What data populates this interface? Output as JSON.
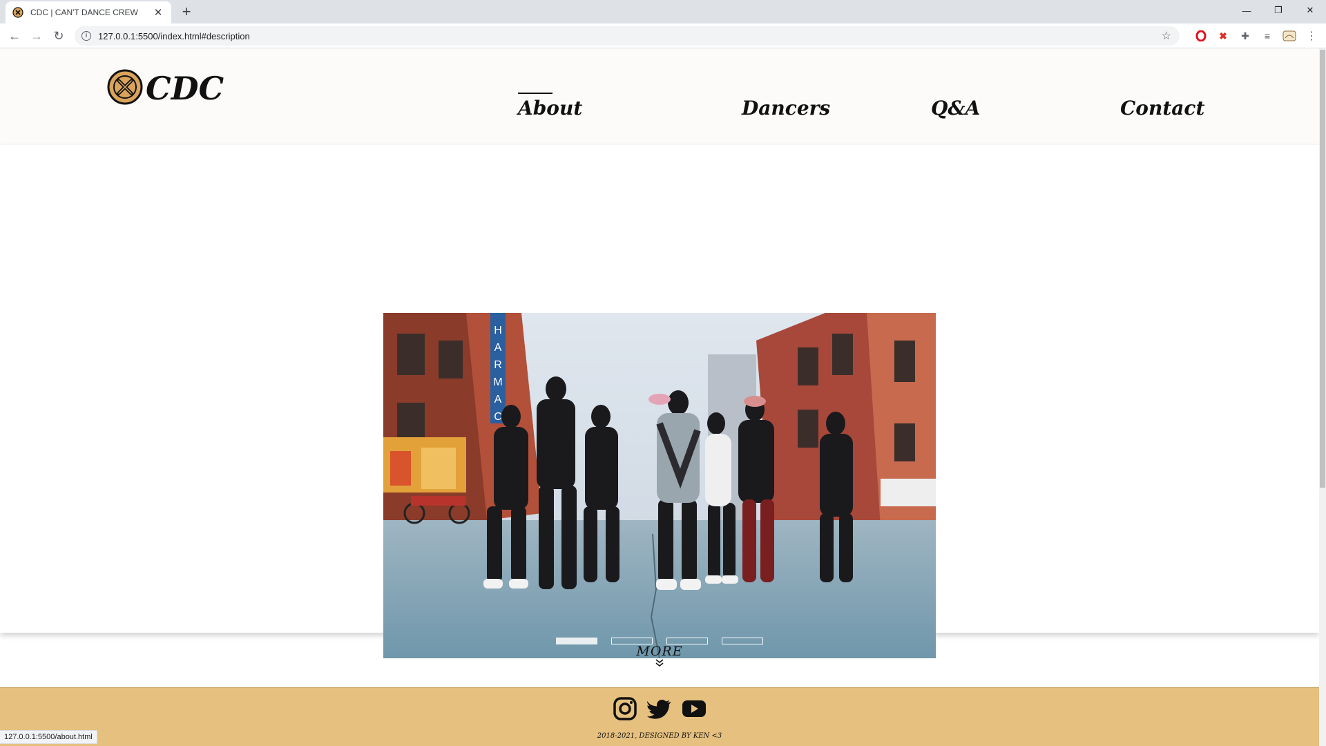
{
  "browser": {
    "tab_title": "CDC | CAN'T DANCE CREW",
    "url": "127.0.0.1:5500/index.html#description",
    "status_url": "127.0.0.1:5500/about.html"
  },
  "site": {
    "logo_text": "CDC",
    "nav": [
      {
        "label": "About",
        "active": true
      },
      {
        "label": "Dancers",
        "active": false
      },
      {
        "label": "Q&A",
        "active": false
      },
      {
        "label": "Contact",
        "active": false
      }
    ],
    "carousel": {
      "slides": 4,
      "active_index": 0
    },
    "more_label": "MORE",
    "social_icons": [
      "instagram-icon",
      "twitter-icon",
      "youtube-icon"
    ],
    "copyright": "2018-2021, DESIGNED BY KEN <3"
  },
  "colors": {
    "footer_bg": "#e5c07e",
    "header_bg": "#fcfbf9",
    "logo_badge": "#d9a35c"
  }
}
